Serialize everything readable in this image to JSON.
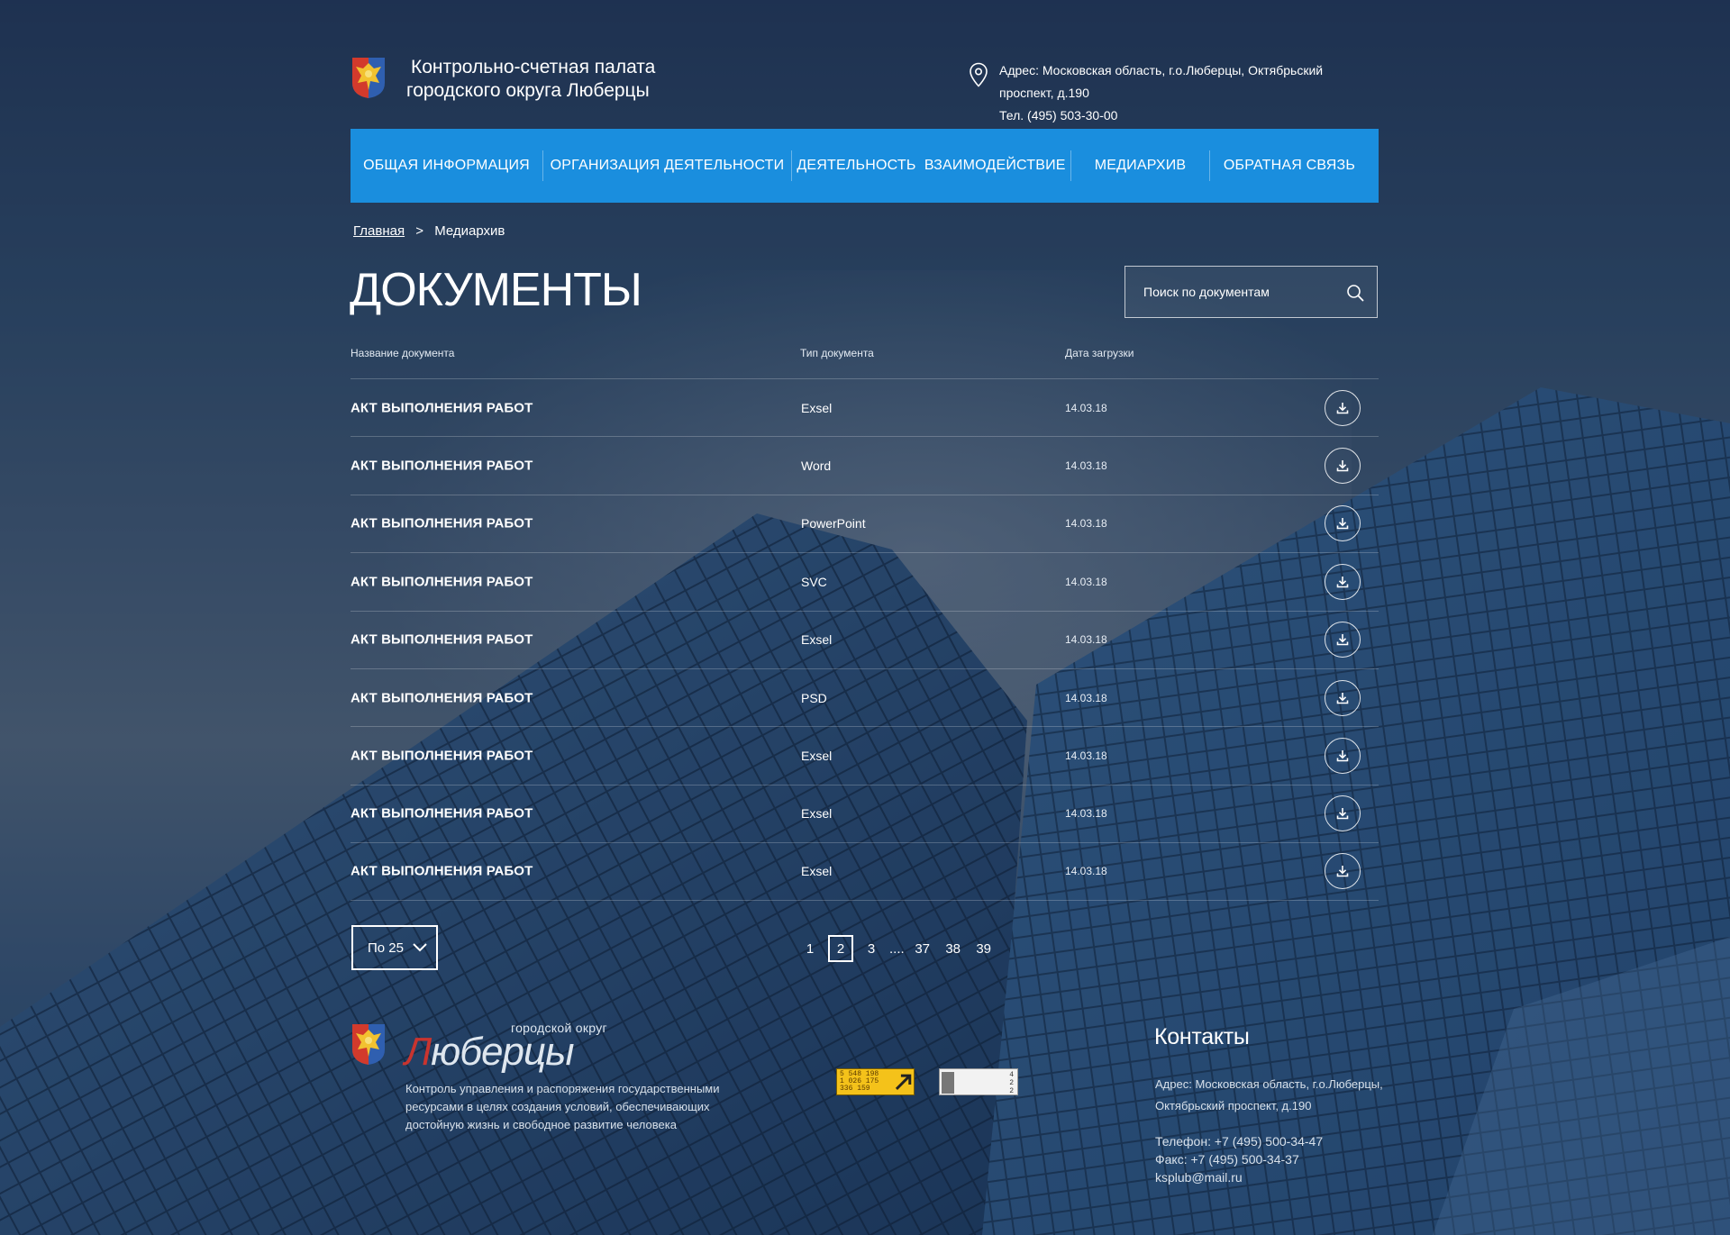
{
  "header": {
    "org_name_line1": "Контрольно-счетная палата",
    "org_name_line2": "городского округа Люберцы",
    "address": "Адрес: Московская область, г.о.Люберцы, Октябрьский проспект, д.190",
    "phone": "Тел. (495) 503-30-00"
  },
  "nav": {
    "items": [
      {
        "label": "ОБЩАЯ ИНФОРМАЦИЯ"
      },
      {
        "label": "ОРГАНИЗАЦИЯ ДЕЯТЕЛЬНОСТИ"
      },
      {
        "label": "ДЕЯТЕЛЬНОСТЬ  ВЗАИМОДЕЙСТВИЕ"
      },
      {
        "label": "МЕДИАРХИВ"
      },
      {
        "label": "ОБРАТНАЯ СВЯЗЬ"
      }
    ]
  },
  "breadcrumb": {
    "home": "Главная",
    "separator": ">",
    "current": "Медиархив"
  },
  "page_title": "ДОКУМЕНТЫ",
  "search": {
    "placeholder": "Поиск по документам"
  },
  "table": {
    "columns": {
      "name": "Название документа",
      "type": "Тип документа",
      "date": "Дата загрузки"
    },
    "rows": [
      {
        "name": "АКТ ВЫПОЛНЕНИЯ РАБОТ",
        "type": "Exsel",
        "date": "14.03.18"
      },
      {
        "name": "АКТ ВЫПОЛНЕНИЯ РАБОТ",
        "type": "Word",
        "date": "14.03.18"
      },
      {
        "name": "АКТ ВЫПОЛНЕНИЯ РАБОТ",
        "type": "PowerPoint",
        "date": "14.03.18"
      },
      {
        "name": "АКТ ВЫПОЛНЕНИЯ РАБОТ",
        "type": "SVC",
        "date": "14.03.18"
      },
      {
        "name": "АКТ ВЫПОЛНЕНИЯ РАБОТ",
        "type": "Exsel",
        "date": "14.03.18"
      },
      {
        "name": "АКТ ВЫПОЛНЕНИЯ РАБОТ",
        "type": "PSD",
        "date": "14.03.18"
      },
      {
        "name": "АКТ ВЫПОЛНЕНИЯ РАБОТ",
        "type": "Exsel",
        "date": "14.03.18"
      },
      {
        "name": "АКТ ВЫПОЛНЕНИЯ РАБОТ",
        "type": "Exsel",
        "date": "14.03.18"
      },
      {
        "name": "АКТ ВЫПОЛНЕНИЯ РАБОТ",
        "type": "Exsel",
        "date": "14.03.18"
      }
    ]
  },
  "pagination": {
    "per_page": "По 25",
    "pages": [
      "1",
      "2",
      "3",
      "....",
      "37",
      "38",
      "39"
    ],
    "current": "2"
  },
  "footer": {
    "brand_small": "городской округ",
    "brand_first_letter": "Л",
    "brand_rest": "юберцы",
    "description": "Контроль управления и распоряжения государственными ресурсами в целях создания условий, обеспечивающих достойную жизнь и свободное развитие человека",
    "counter1_lines": [
      "5 548 198",
      "1 026 175",
      "336 159"
    ],
    "counter2_lines": [
      "4",
      "2",
      "2"
    ],
    "contacts_title": "Контакты",
    "contacts_address": "Адрес: Московская область, г.о.Люберцы, Октябрьский проспект, д.190",
    "contacts_phone": "Телефон: +7 (495) 500-34-47",
    "contacts_fax": "Факс: +7 (495) 500-34-37",
    "contacts_email": "ksplub@mail.ru"
  },
  "colors": {
    "nav_bg": "#1a8ede",
    "brand_red": "#c9342f",
    "counter_yellow": "#f4c21a"
  },
  "icons": [
    "coat-of-arms-icon",
    "map-pin-icon",
    "search-icon",
    "download-icon",
    "chevron-down-icon",
    "counter-arrow-icon"
  ]
}
